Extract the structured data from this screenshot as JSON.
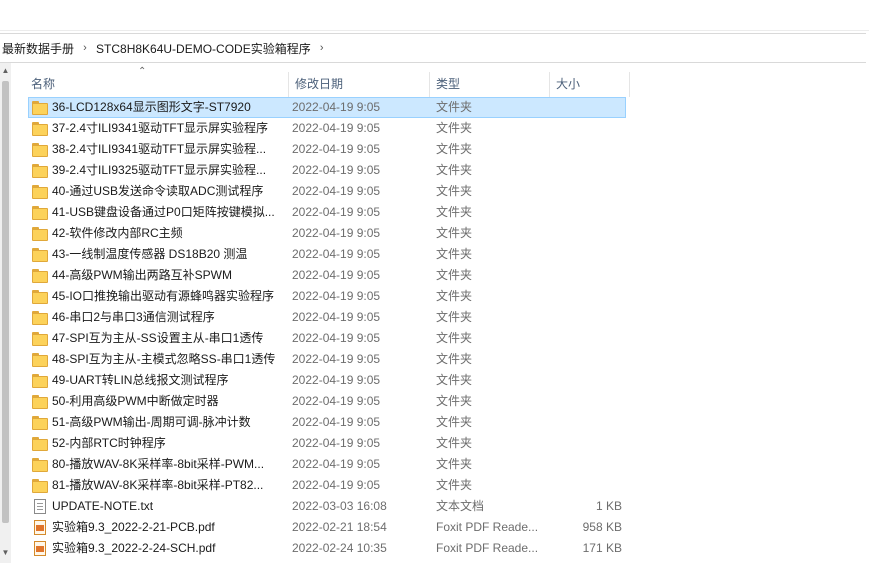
{
  "breadcrumb": [
    "最新数据手册",
    "STC8H8K64U-DEMO-CODE实验箱程序"
  ],
  "columns": {
    "name": "名称",
    "date": "修改日期",
    "type": "类型",
    "size": "大小"
  },
  "files": [
    {
      "name": "36-LCD128x64显示图形文字-ST7920",
      "date": "2022-04-19 9:05",
      "type": "文件夹",
      "size": "",
      "icon": "folder-icon",
      "selected": true
    },
    {
      "name": "37-2.4寸ILI9341驱动TFT显示屏实验程序",
      "date": "2022-04-19 9:05",
      "type": "文件夹",
      "size": "",
      "icon": "folder-icon"
    },
    {
      "name": "38-2.4寸ILI9341驱动TFT显示屏实验程...",
      "date": "2022-04-19 9:05",
      "type": "文件夹",
      "size": "",
      "icon": "folder-icon"
    },
    {
      "name": "39-2.4寸ILI9325驱动TFT显示屏实验程...",
      "date": "2022-04-19 9:05",
      "type": "文件夹",
      "size": "",
      "icon": "folder-icon"
    },
    {
      "name": "40-通过USB发送命令读取ADC测试程序",
      "date": "2022-04-19 9:05",
      "type": "文件夹",
      "size": "",
      "icon": "folder-icon"
    },
    {
      "name": "41-USB键盘设备通过P0口矩阵按键模拟...",
      "date": "2022-04-19 9:05",
      "type": "文件夹",
      "size": "",
      "icon": "folder-icon"
    },
    {
      "name": "42-软件修改内部RC主频",
      "date": "2022-04-19 9:05",
      "type": "文件夹",
      "size": "",
      "icon": "folder-icon"
    },
    {
      "name": "43-一线制温度传感器 DS18B20 测温",
      "date": "2022-04-19 9:05",
      "type": "文件夹",
      "size": "",
      "icon": "folder-icon"
    },
    {
      "name": "44-高级PWM输出两路互补SPWM",
      "date": "2022-04-19 9:05",
      "type": "文件夹",
      "size": "",
      "icon": "folder-icon"
    },
    {
      "name": "45-IO口推挽输出驱动有源蜂鸣器实验程序",
      "date": "2022-04-19 9:05",
      "type": "文件夹",
      "size": "",
      "icon": "folder-icon"
    },
    {
      "name": "46-串口2与串口3通信测试程序",
      "date": "2022-04-19 9:05",
      "type": "文件夹",
      "size": "",
      "icon": "folder-icon"
    },
    {
      "name": "47-SPI互为主从-SS设置主从-串口1透传",
      "date": "2022-04-19 9:05",
      "type": "文件夹",
      "size": "",
      "icon": "folder-icon"
    },
    {
      "name": "48-SPI互为主从-主模式忽略SS-串口1透传",
      "date": "2022-04-19 9:05",
      "type": "文件夹",
      "size": "",
      "icon": "folder-icon"
    },
    {
      "name": "49-UART转LIN总线报文测试程序",
      "date": "2022-04-19 9:05",
      "type": "文件夹",
      "size": "",
      "icon": "folder-icon"
    },
    {
      "name": "50-利用高级PWM中断做定时器",
      "date": "2022-04-19 9:05",
      "type": "文件夹",
      "size": "",
      "icon": "folder-icon"
    },
    {
      "name": "51-高级PWM输出-周期可调-脉冲计数",
      "date": "2022-04-19 9:05",
      "type": "文件夹",
      "size": "",
      "icon": "folder-icon"
    },
    {
      "name": "52-内部RTC时钟程序",
      "date": "2022-04-19 9:05",
      "type": "文件夹",
      "size": "",
      "icon": "folder-icon"
    },
    {
      "name": "80-播放WAV-8K采样率-8bit采样-PWM...",
      "date": "2022-04-19 9:05",
      "type": "文件夹",
      "size": "",
      "icon": "folder-icon"
    },
    {
      "name": "81-播放WAV-8K采样率-8bit采样-PT82...",
      "date": "2022-04-19 9:05",
      "type": "文件夹",
      "size": "",
      "icon": "folder-icon"
    },
    {
      "name": "UPDATE-NOTE.txt",
      "date": "2022-03-03 16:08",
      "type": "文本文档",
      "size": "1 KB",
      "icon": "text-file-icon"
    },
    {
      "name": "实验箱9.3_2022-2-21-PCB.pdf",
      "date": "2022-02-21 18:54",
      "type": "Foxit PDF Reade...",
      "size": "958 KB",
      "icon": "pdf-file-icon"
    },
    {
      "name": "实验箱9.3_2022-2-24-SCH.pdf",
      "date": "2022-02-24 10:35",
      "type": "Foxit PDF Reade...",
      "size": "171 KB",
      "icon": "pdf-file-icon"
    }
  ]
}
